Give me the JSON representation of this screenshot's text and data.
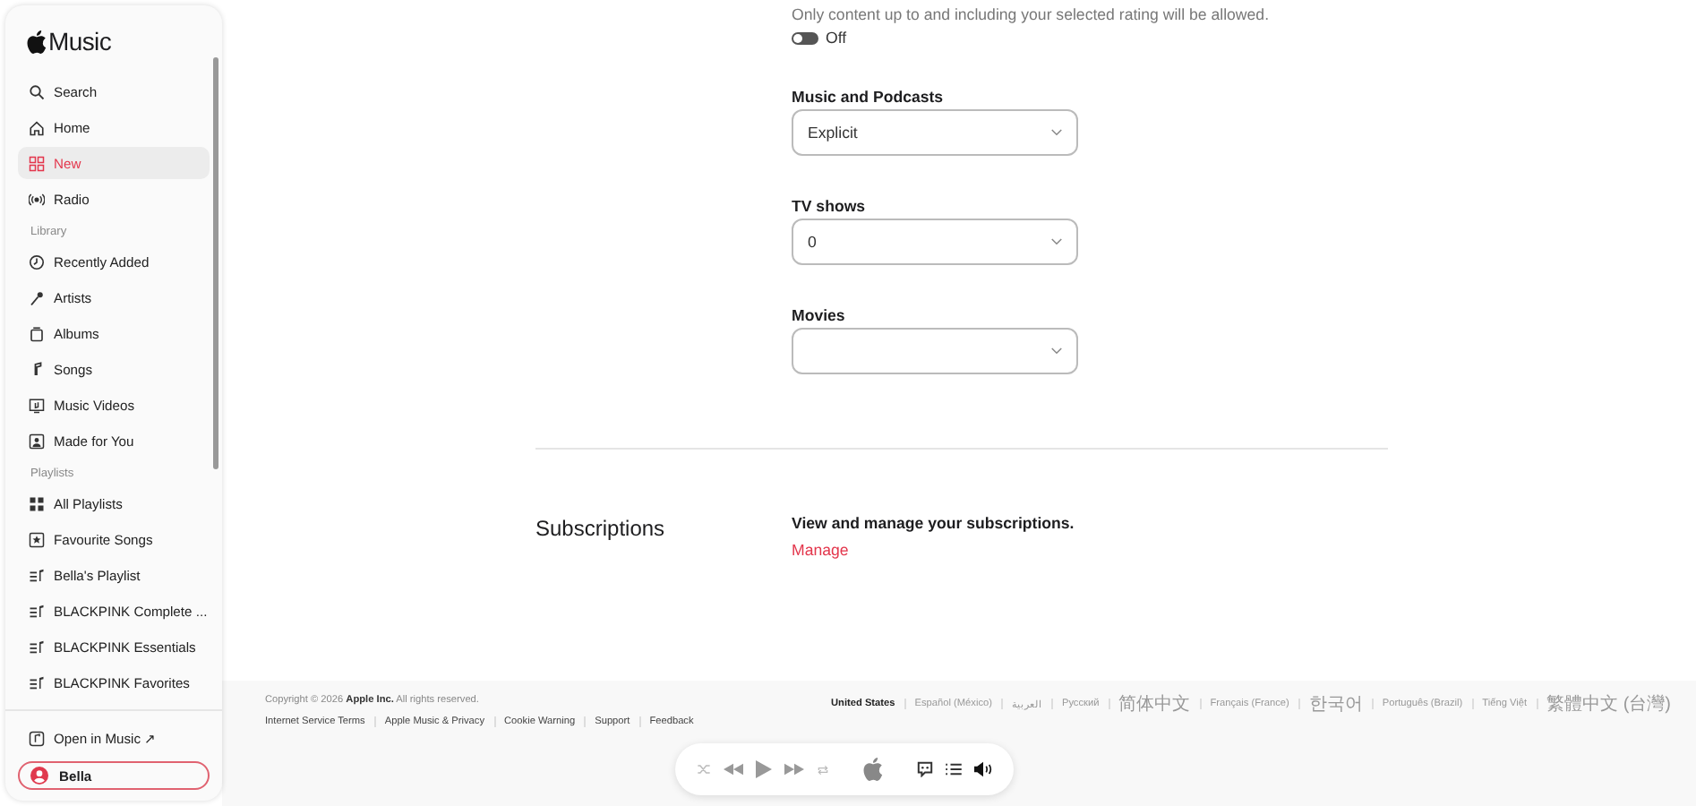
{
  "sidebar": {
    "title": "Music",
    "nav": [
      {
        "label": "Search",
        "selected": false
      },
      {
        "label": "Home",
        "selected": false
      },
      {
        "label": "New",
        "selected": true
      },
      {
        "label": "Radio",
        "selected": false
      }
    ],
    "library": {
      "heading": "Library",
      "items": [
        {
          "label": "Recently Added",
          "selected": false
        },
        {
          "label": "Artists",
          "selected": false
        },
        {
          "label": "Albums",
          "selected": false
        },
        {
          "label": "Songs",
          "selected": false
        },
        {
          "label": "Music Videos",
          "selected": false
        },
        {
          "label": "Made for You",
          "selected": false
        }
      ]
    },
    "playlists": {
      "heading": "Playlists",
      "items": [
        {
          "label": "All Playlists",
          "selected": false
        },
        {
          "label": "Favourite Songs",
          "selected": false
        },
        {
          "label": "Bella's Playlist",
          "selected": false
        },
        {
          "label": "BLACKPINK Complete ...",
          "selected": false
        },
        {
          "label": "BLACKPINK Essentials",
          "selected": false
        },
        {
          "label": "BLACKPINK Favorites",
          "selected": false
        }
      ]
    },
    "open_in_music": "Open in Music ↗",
    "account": {
      "name": "Bella",
      "focused": true
    }
  },
  "content_restrictions": {
    "description": "Only content up to and including your selected rating will be allowed.",
    "toggle": {
      "on": false,
      "label": "Off"
    },
    "selects": [
      {
        "label": "Music and Podcasts",
        "value": "Explicit"
      },
      {
        "label": "TV shows",
        "value": "0"
      },
      {
        "label": "Movies"
      }
    ]
  },
  "subscriptions": {
    "title": "Subscriptions",
    "description": "View and manage your subscriptions.",
    "link": "Manage"
  },
  "footer": {
    "copyright": "Copyright © 2026 **Apple Inc.** All rights reserved.",
    "links": [
      "Internet Service Terms",
      "Apple Music & Privacy",
      "Cookie Warning",
      "Support",
      "Feedback"
    ],
    "languages": [
      {
        "label": "United States",
        "selected": true
      },
      {
        "label": "Español (México)",
        "selected": false
      },
      {
        "label": "العربية",
        "selected": false
      },
      {
        "label": "Русский",
        "selected": false
      },
      {
        "label": "简体中文",
        "selected": false
      },
      {
        "label": "Français (France)",
        "selected": false
      },
      {
        "label": "한국어",
        "selected": false
      },
      {
        "label": "Português (Brazil)",
        "selected": false
      },
      {
        "label": "Tiếng Việt",
        "selected": false
      },
      {
        "label": "繁體中文 (台灣)",
        "selected": false
      }
    ]
  }
}
